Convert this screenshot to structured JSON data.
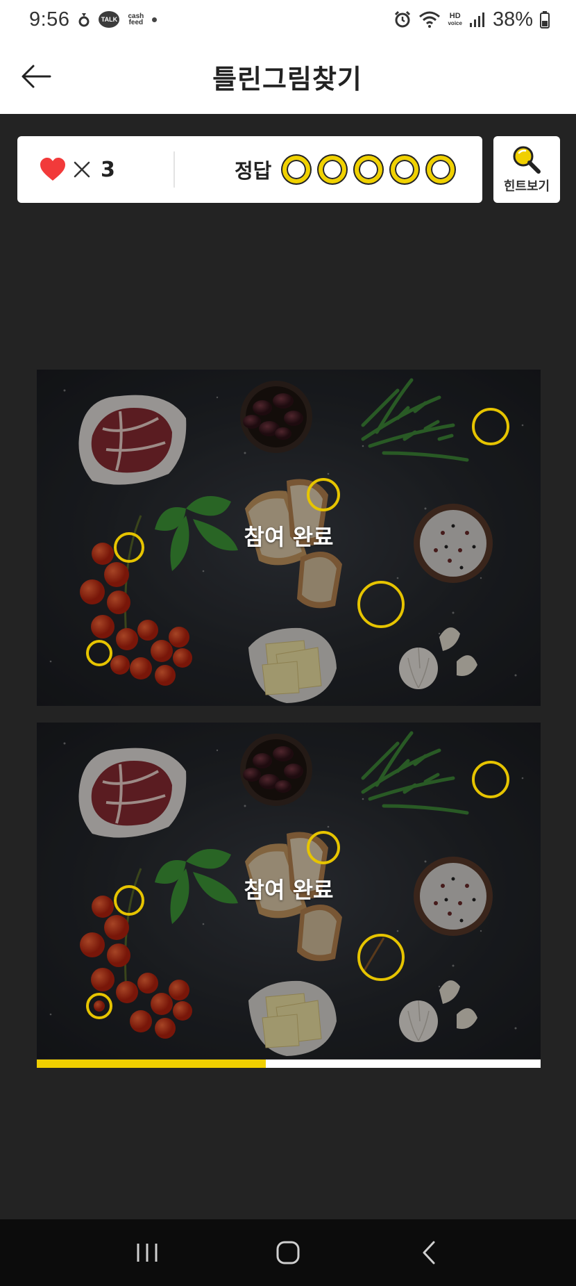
{
  "status_bar": {
    "time": "9:56",
    "talk_label": "TALK",
    "cashfeed_label_1": "cash",
    "cashfeed_label_2": "feed",
    "hd_label_1": "HD",
    "hd_label_2": "voice",
    "battery": "38%"
  },
  "header": {
    "title": "틀린그림찾기"
  },
  "score": {
    "lives_symbol": "×",
    "lives": "3",
    "answers_label": "정답",
    "answers_total": 5,
    "answers_found": 0
  },
  "hint_button": {
    "label": "힌트보기"
  },
  "puzzle": {
    "overlay_text": "참여 완료"
  },
  "progress": {
    "fraction": 0.454
  },
  "colors": {
    "accent_yellow": "#f0cf00",
    "heart_red": "#f23a3a",
    "background": "#232323"
  }
}
